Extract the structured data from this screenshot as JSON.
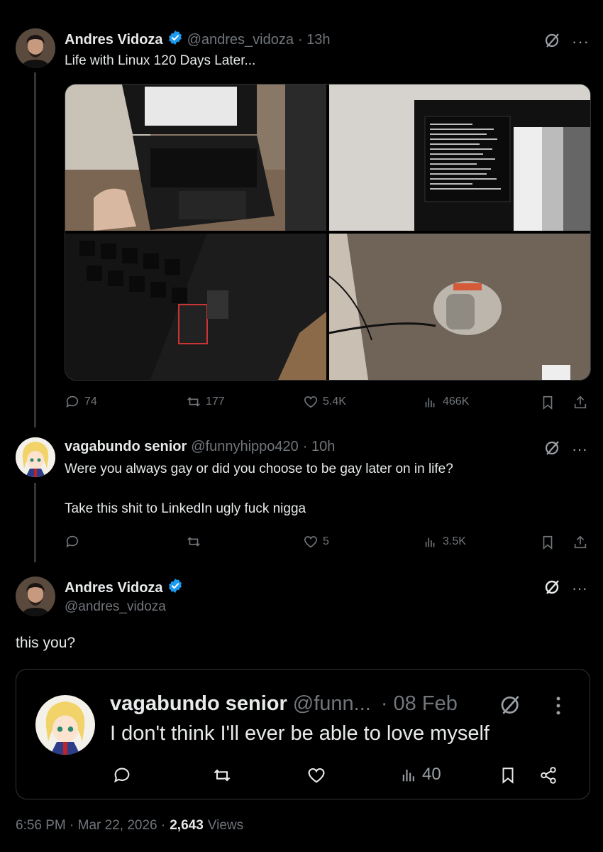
{
  "tweet1": {
    "name": "Andres Vidoza",
    "handle": "@andres_vidoza",
    "time": "· 13h",
    "text": "Life with Linux 120 Days Later...",
    "replies": "74",
    "retweets": "177",
    "likes": "5.4K",
    "views": "466K"
  },
  "tweet2": {
    "name": "vagabundo senior",
    "handle": "@funnyhippo420",
    "time": "· 10h",
    "text_line1": "Were you always gay or did you choose to be gay later on in life?",
    "text_line2": "Take this shit to LinkedIn ugly fuck nigga",
    "likes": "5",
    "views": "3.5K"
  },
  "tweet3": {
    "name": "Andres Vidoza",
    "handle": "@andres_vidoza",
    "text": "this you?",
    "footer_time": "6:56 PM · Mar 22, 2026 ·",
    "footer_views_count": "2,643",
    "footer_views_label": "Views"
  },
  "quoted": {
    "name": "vagabundo senior",
    "handle": "@funn...",
    "time": "· 08 Feb",
    "text": "I don't think I'll ever be able to love myself",
    "views": "40"
  },
  "colors": {
    "background": "#000000",
    "text": "#e7e9ea",
    "muted": "#71767b",
    "verified": "#1d9bf0",
    "border": "#2f3336"
  },
  "icons": [
    "grok-icon",
    "more-icon",
    "reply-icon",
    "retweet-icon",
    "like-icon",
    "views-icon",
    "bookmark-icon",
    "share-icon",
    "verified-badge-icon"
  ]
}
